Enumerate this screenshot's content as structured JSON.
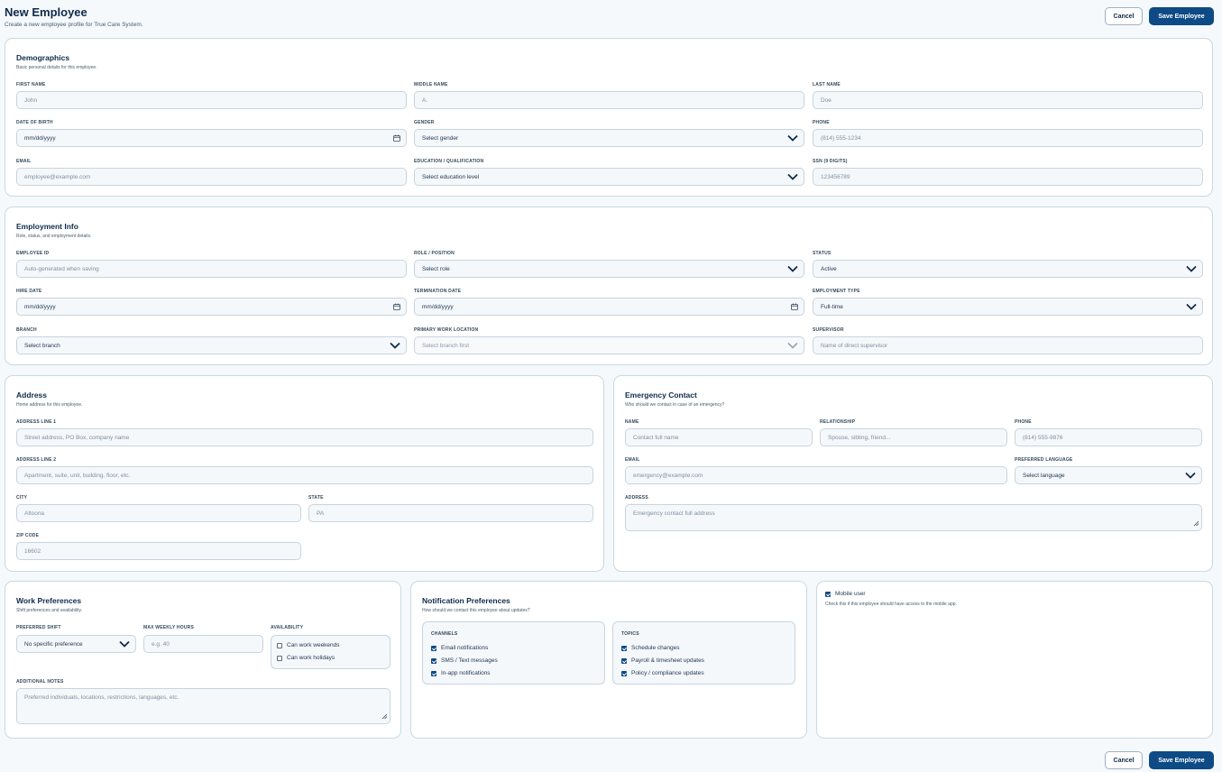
{
  "header": {
    "title": "New Employee",
    "subtitle": "Create a new employee profile for True Care System.",
    "cancel_label": "Cancel",
    "save_label": "Save Employee"
  },
  "demographics": {
    "title": "Demographics",
    "subtitle": "Basic personal details for this employee.",
    "first_name": {
      "label": "FIRST NAME",
      "placeholder": "John"
    },
    "middle_name": {
      "label": "MIDDLE NAME",
      "placeholder": "A."
    },
    "last_name": {
      "label": "LAST NAME",
      "placeholder": "Doe"
    },
    "dob": {
      "label": "DATE OF BIRTH",
      "value": "mm/dd/yyyy"
    },
    "gender": {
      "label": "GENDER",
      "value": "Select gender"
    },
    "phone": {
      "label": "PHONE",
      "placeholder": "(814) 555-1234"
    },
    "email": {
      "label": "EMAIL",
      "placeholder": "employee@example.com"
    },
    "education": {
      "label": "EDUCATION / QUALIFICATION",
      "value": "Select education level"
    },
    "ssn": {
      "label": "SSN (9 DIGITS)",
      "placeholder": "123456789"
    }
  },
  "employment": {
    "title": "Employment Info",
    "subtitle": "Role, status, and employment details.",
    "employee_id": {
      "label": "EMPLOYEE ID",
      "placeholder": "Auto-generated when saving"
    },
    "role": {
      "label": "ROLE / POSITION",
      "value": "Select role"
    },
    "status": {
      "label": "STATUS",
      "value": "Active"
    },
    "hire_date": {
      "label": "HIRE DATE",
      "value": "mm/dd/yyyy"
    },
    "termination_date": {
      "label": "TERMINATION DATE",
      "value": "mm/dd/yyyy"
    },
    "employment_type": {
      "label": "EMPLOYMENT TYPE",
      "value": "Full-time"
    },
    "branch": {
      "label": "BRANCH",
      "value": "Select branch"
    },
    "primary_location": {
      "label": "PRIMARY WORK LOCATION",
      "value": "Select branch first"
    },
    "supervisor": {
      "label": "SUPERVISOR",
      "placeholder": "Name of direct supervisor"
    }
  },
  "address": {
    "title": "Address",
    "subtitle": "Home address for this employee.",
    "line1": {
      "label": "ADDRESS LINE 1",
      "placeholder": "Street address, PO Box, company name"
    },
    "line2": {
      "label": "ADDRESS LINE 2",
      "placeholder": "Apartment, suite, unit, building, floor, etc."
    },
    "city": {
      "label": "CITY",
      "placeholder": "Altoona"
    },
    "state": {
      "label": "STATE",
      "placeholder": "PA"
    },
    "zip": {
      "label": "ZIP CODE",
      "placeholder": "16602"
    }
  },
  "emergency": {
    "title": "Emergency Contact",
    "subtitle": "Who should we contact in case of an emergency?",
    "name": {
      "label": "NAME",
      "placeholder": "Contact full name"
    },
    "relationship": {
      "label": "RELATIONSHIP",
      "placeholder": "Spouse, sibling, friend..."
    },
    "phone": {
      "label": "PHONE",
      "placeholder": "(814) 555-9876"
    },
    "email": {
      "label": "EMAIL",
      "placeholder": "emergency@example.com"
    },
    "language": {
      "label": "PREFERRED LANGUAGE",
      "value": "Select language"
    },
    "address": {
      "label": "ADDRESS",
      "placeholder": "Emergency contact full address"
    }
  },
  "work_prefs": {
    "title": "Work Preferences",
    "subtitle": "Shift preferences and availability.",
    "shift": {
      "label": "PREFERRED SHIFT",
      "value": "No specific preference"
    },
    "max_hours": {
      "label": "MAX WEEKLY HOURS",
      "placeholder": "e.g. 40"
    },
    "availability": {
      "label": "AVAILABILITY",
      "weekends": "Can work weekends",
      "holidays": "Can work holidays"
    },
    "notes": {
      "label": "ADDITIONAL NOTES",
      "placeholder": "Preferred individuals, locations, restrictions, languages, etc."
    }
  },
  "notifications": {
    "title": "Notification Preferences",
    "subtitle": "How should we contact this employee about updates?",
    "channels_title": "CHANNELS",
    "channels": [
      "Email notifications",
      "SMS / Text messages",
      "In-app notifications"
    ],
    "topics_title": "TOPICS",
    "topics": [
      "Schedule changes",
      "Payroll & timesheet updates",
      "Policy / compliance updates"
    ]
  },
  "mobile": {
    "label": "Mobile user",
    "helper": "Check this if this employee should have access to the mobile app."
  },
  "footer": {
    "cancel_label": "Cancel",
    "save_label": "Save Employee"
  }
}
